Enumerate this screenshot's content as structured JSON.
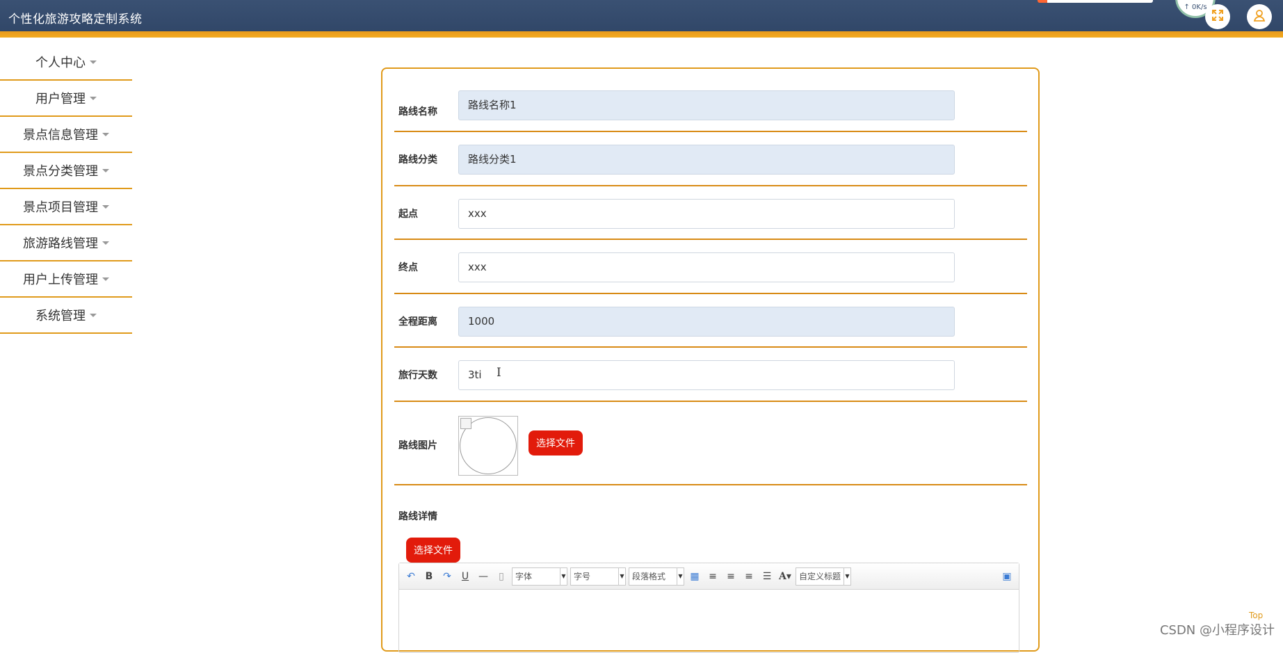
{
  "header": {
    "title": "个性化旅游攻略定制系统",
    "speed": "↑ 0K/s",
    "fullscreen_icon": "expand-icon",
    "user_icon": "user-icon"
  },
  "sidebar": {
    "items": [
      {
        "label": "个人中心"
      },
      {
        "label": "用户管理"
      },
      {
        "label": "景点信息管理"
      },
      {
        "label": "景点分类管理"
      },
      {
        "label": "景点项目管理"
      },
      {
        "label": "旅游路线管理"
      },
      {
        "label": "用户上传管理"
      },
      {
        "label": "系统管理"
      }
    ]
  },
  "form": {
    "route_name": {
      "label": "路线名称",
      "value": "路线名称1"
    },
    "route_category": {
      "label": "路线分类",
      "value": "路线分类1"
    },
    "start": {
      "label": "起点",
      "value": "xxx"
    },
    "end": {
      "label": "终点",
      "value": "xxx"
    },
    "distance": {
      "label": "全程距离",
      "value": "1000"
    },
    "days": {
      "label": "旅行天数",
      "value": "3ti"
    },
    "picture": {
      "label": "路线图片",
      "button": "选择文件"
    },
    "details": {
      "label": "路线详情",
      "button": "选择文件"
    }
  },
  "editor": {
    "font_family": "字体",
    "font_size": "字号",
    "paragraph": "段落格式",
    "custom_title": "自定义标题"
  },
  "colors": {
    "accent": "#e09a1a",
    "header": "#34496b",
    "danger": "#e21b0b",
    "readonly_bg": "#e1eaf5"
  },
  "footer": {
    "top": "Top",
    "watermark": "CSDN @小程序设计"
  }
}
